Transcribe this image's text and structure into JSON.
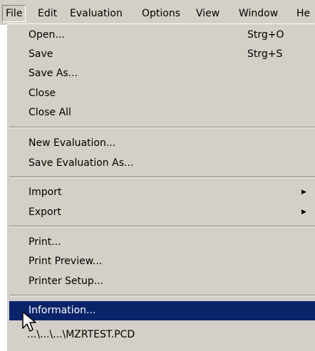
{
  "menubar": {
    "items": [
      {
        "label": "File"
      },
      {
        "label": "Edit"
      },
      {
        "label": "Evaluation"
      },
      {
        "label": "Options"
      },
      {
        "label": "View"
      },
      {
        "label": "Window"
      },
      {
        "label": "He"
      }
    ]
  },
  "file_menu": {
    "items": [
      {
        "label": "Open...",
        "shortcut": "Strg+O"
      },
      {
        "label": "Save",
        "shortcut": "Strg+S"
      },
      {
        "label": "Save As..."
      },
      {
        "label": "Close"
      },
      {
        "label": "Close All"
      },
      {
        "label": "New Evaluation..."
      },
      {
        "label": "Save Evaluation As..."
      },
      {
        "label": "Import",
        "arrow": "▶"
      },
      {
        "label": "Export",
        "arrow": "▶"
      },
      {
        "label": "Print..."
      },
      {
        "label": "Print Preview..."
      },
      {
        "label": "Printer Setup..."
      },
      {
        "label": "Information..."
      }
    ]
  },
  "background_text": "...\\...\\...\\MZRTEST.PCD",
  "colors": {
    "menu_bg": "#d4d0c8",
    "highlight_bg": "#0a246a",
    "highlight_text": "#ffffff"
  }
}
